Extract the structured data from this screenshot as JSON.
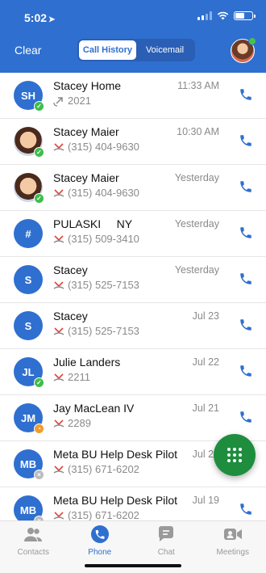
{
  "status_bar": {
    "time": "5:02",
    "battery_level": 0.55
  },
  "header": {
    "clear_label": "Clear",
    "tabs": [
      {
        "label": "Call History",
        "active": true
      },
      {
        "label": "Voicemail",
        "active": false
      }
    ]
  },
  "calls": [
    {
      "initials": "SH",
      "photo": false,
      "presence": "available",
      "name": "Stacey Home",
      "direction": "outgoing",
      "number": "2021",
      "time": "11:33 AM"
    },
    {
      "initials": "",
      "photo": true,
      "presence": "available",
      "name": "Stacey Maier",
      "direction": "missed",
      "number": "(315) 404-9630",
      "time": "10:30 AM"
    },
    {
      "initials": "",
      "photo": true,
      "presence": "available",
      "name": "Stacey Maier",
      "direction": "missed",
      "number": "(315) 404-9630",
      "time": "Yesterday"
    },
    {
      "initials": "#",
      "photo": false,
      "presence": "none",
      "name": "PULASKI     NY",
      "direction": "missed",
      "number": "(315) 509-3410",
      "time": "Yesterday"
    },
    {
      "initials": "S",
      "photo": false,
      "presence": "none",
      "name": "Stacey",
      "direction": "missed",
      "number": "(315) 525-7153",
      "time": "Yesterday"
    },
    {
      "initials": "S",
      "photo": false,
      "presence": "none",
      "name": "Stacey",
      "direction": "missed",
      "number": "(315) 525-7153",
      "time": "Jul 23"
    },
    {
      "initials": "JL",
      "photo": false,
      "presence": "available",
      "name": "Julie Landers",
      "direction": "missed",
      "number": "2211",
      "time": "Jul 22"
    },
    {
      "initials": "JM",
      "photo": false,
      "presence": "away",
      "name": "Jay MacLean IV",
      "direction": "missed",
      "number": "2289",
      "time": "Jul 21"
    },
    {
      "initials": "MB",
      "photo": false,
      "presence": "offline",
      "name": "Meta BU Help Desk Pilot",
      "direction": "missed",
      "number": "(315) 671-6202",
      "time": "Jul 20"
    },
    {
      "initials": "MB",
      "photo": false,
      "presence": "offline",
      "name": "Meta BU Help Desk Pilot",
      "direction": "missed",
      "number": "(315) 671-6202",
      "time": "Jul 19"
    }
  ],
  "tabbar": [
    {
      "label": "Contacts",
      "icon": "contacts-icon",
      "active": false
    },
    {
      "label": "Phone",
      "icon": "phone-icon",
      "active": true
    },
    {
      "label": "Chat",
      "icon": "chat-icon",
      "active": false
    },
    {
      "label": "Meetings",
      "icon": "meetings-icon",
      "active": false
    }
  ],
  "colors": {
    "brand": "#2f6fcf",
    "fab": "#1e8e3e",
    "missed": "#e0433a",
    "available": "#3ebd4a",
    "away": "#f29a2e"
  }
}
